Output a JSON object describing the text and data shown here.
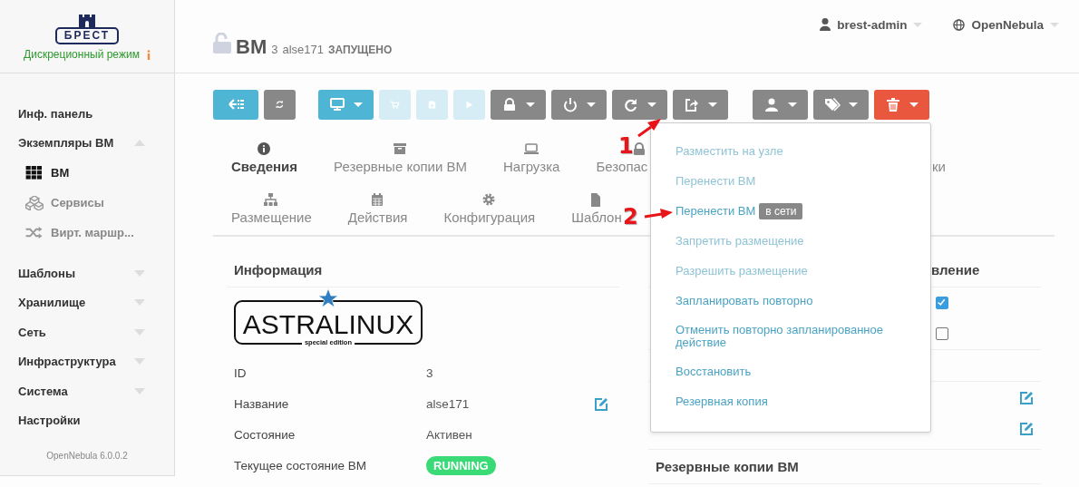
{
  "sidebar": {
    "logo": {
      "text": "БРЕСТ"
    },
    "mode": "Дискреционный режим",
    "items": [
      {
        "label": "Инф. панель"
      },
      {
        "label": "Экземпляры ВМ",
        "expanded": true,
        "children": [
          {
            "label": "ВМ",
            "selected": true
          },
          {
            "label": "Сервисы",
            "selected": false
          },
          {
            "label": "Вирт. маршр...",
            "selected": false
          }
        ]
      },
      {
        "label": "Шаблоны",
        "expanded": false
      },
      {
        "label": "Хранилище",
        "expanded": false
      },
      {
        "label": "Сеть",
        "expanded": false
      },
      {
        "label": "Инфраструктура",
        "expanded": false
      },
      {
        "label": "Система",
        "expanded": false
      },
      {
        "label": "Настройки"
      }
    ],
    "footer": "OpenNebula 6.0.0.2"
  },
  "header": {
    "title": "ВМ",
    "id": "3",
    "name": "alse171",
    "state": "ЗАПУЩЕНО",
    "user": "brest-admin",
    "zone": "OpenNebula"
  },
  "toolbar": [
    {
      "kind": "primary",
      "disabled": false,
      "caret": false
    },
    {
      "kind": "secondary",
      "disabled": false,
      "caret": false
    },
    {
      "kind": "primary",
      "disabled": false,
      "caret": true
    },
    {
      "kind": "primary",
      "disabled": true,
      "caret": false
    },
    {
      "kind": "primary",
      "disabled": true,
      "caret": false
    },
    {
      "kind": "primary",
      "disabled": true,
      "caret": false
    },
    {
      "kind": "secondary",
      "disabled": false,
      "caret": true
    },
    {
      "kind": "secondary",
      "disabled": false,
      "caret": true
    },
    {
      "kind": "secondary",
      "disabled": false,
      "caret": true
    },
    {
      "kind": "secondary",
      "disabled": false,
      "caret": true
    },
    {
      "kind": "secondary",
      "disabled": false,
      "caret": true
    },
    {
      "kind": "secondary",
      "disabled": false,
      "caret": true
    },
    {
      "kind": "alert",
      "disabled": false,
      "caret": true
    }
  ],
  "tabs": [
    [
      {
        "label": "Сведения",
        "selected": true
      },
      {
        "label": "Резервные копии ВМ",
        "selected": false
      },
      {
        "label": "Нагрузка",
        "selected": false
      },
      {
        "label": "Безопас",
        "selected": false
      },
      {
        "label": "ки",
        "selected": false
      }
    ],
    [
      {
        "label": "Размещение",
        "selected": false
      },
      {
        "label": "Действия",
        "selected": false
      },
      {
        "label": "Конфигурация",
        "selected": false
      },
      {
        "label": "Шаблон",
        "selected": false
      }
    ]
  ],
  "info_panel": {
    "title": "Информация",
    "logo": {
      "text": "ASTRALINUX",
      "subtitle": "special edition"
    },
    "rows": [
      {
        "label": "ID",
        "value": "3",
        "kind": "text",
        "editable": false
      },
      {
        "label": "Название",
        "value": "alse171",
        "kind": "text",
        "editable": true
      },
      {
        "label": "Состояние",
        "value": "Активен",
        "kind": "text",
        "editable": false
      },
      {
        "label": "Текущее состояние ВМ",
        "value": "RUNNING",
        "kind": "badge",
        "editable": false
      }
    ]
  },
  "right_panel": {
    "title": "вление",
    "rows": [
      {
        "kind": "checkbox",
        "checked": true
      },
      {
        "kind": "checkbox",
        "checked": false
      },
      {
        "kind": "empty"
      },
      {
        "kind": "edit"
      },
      {
        "kind": "edit"
      }
    ],
    "section": "Резервные копии ВМ"
  },
  "menu": {
    "items": [
      {
        "label": "Разместить на узле",
        "disabled": true
      },
      {
        "label": "Перенести ВМ",
        "disabled": true
      },
      {
        "label": "Перенести ВМ",
        "disabled": false,
        "badge": "в сети"
      },
      {
        "label": "Запретить размещение",
        "disabled": true
      },
      {
        "label": "Разрешить размещение",
        "disabled": true
      },
      {
        "label": "Запланировать повторно",
        "disabled": false
      },
      {
        "label": "Отменить повторно запланированное действие",
        "disabled": false
      },
      {
        "label": "Восстановить",
        "disabled": false
      },
      {
        "label": "Резервная копия",
        "disabled": false
      }
    ]
  },
  "annotations": [
    {
      "label": "1"
    },
    {
      "label": "2"
    }
  ]
}
